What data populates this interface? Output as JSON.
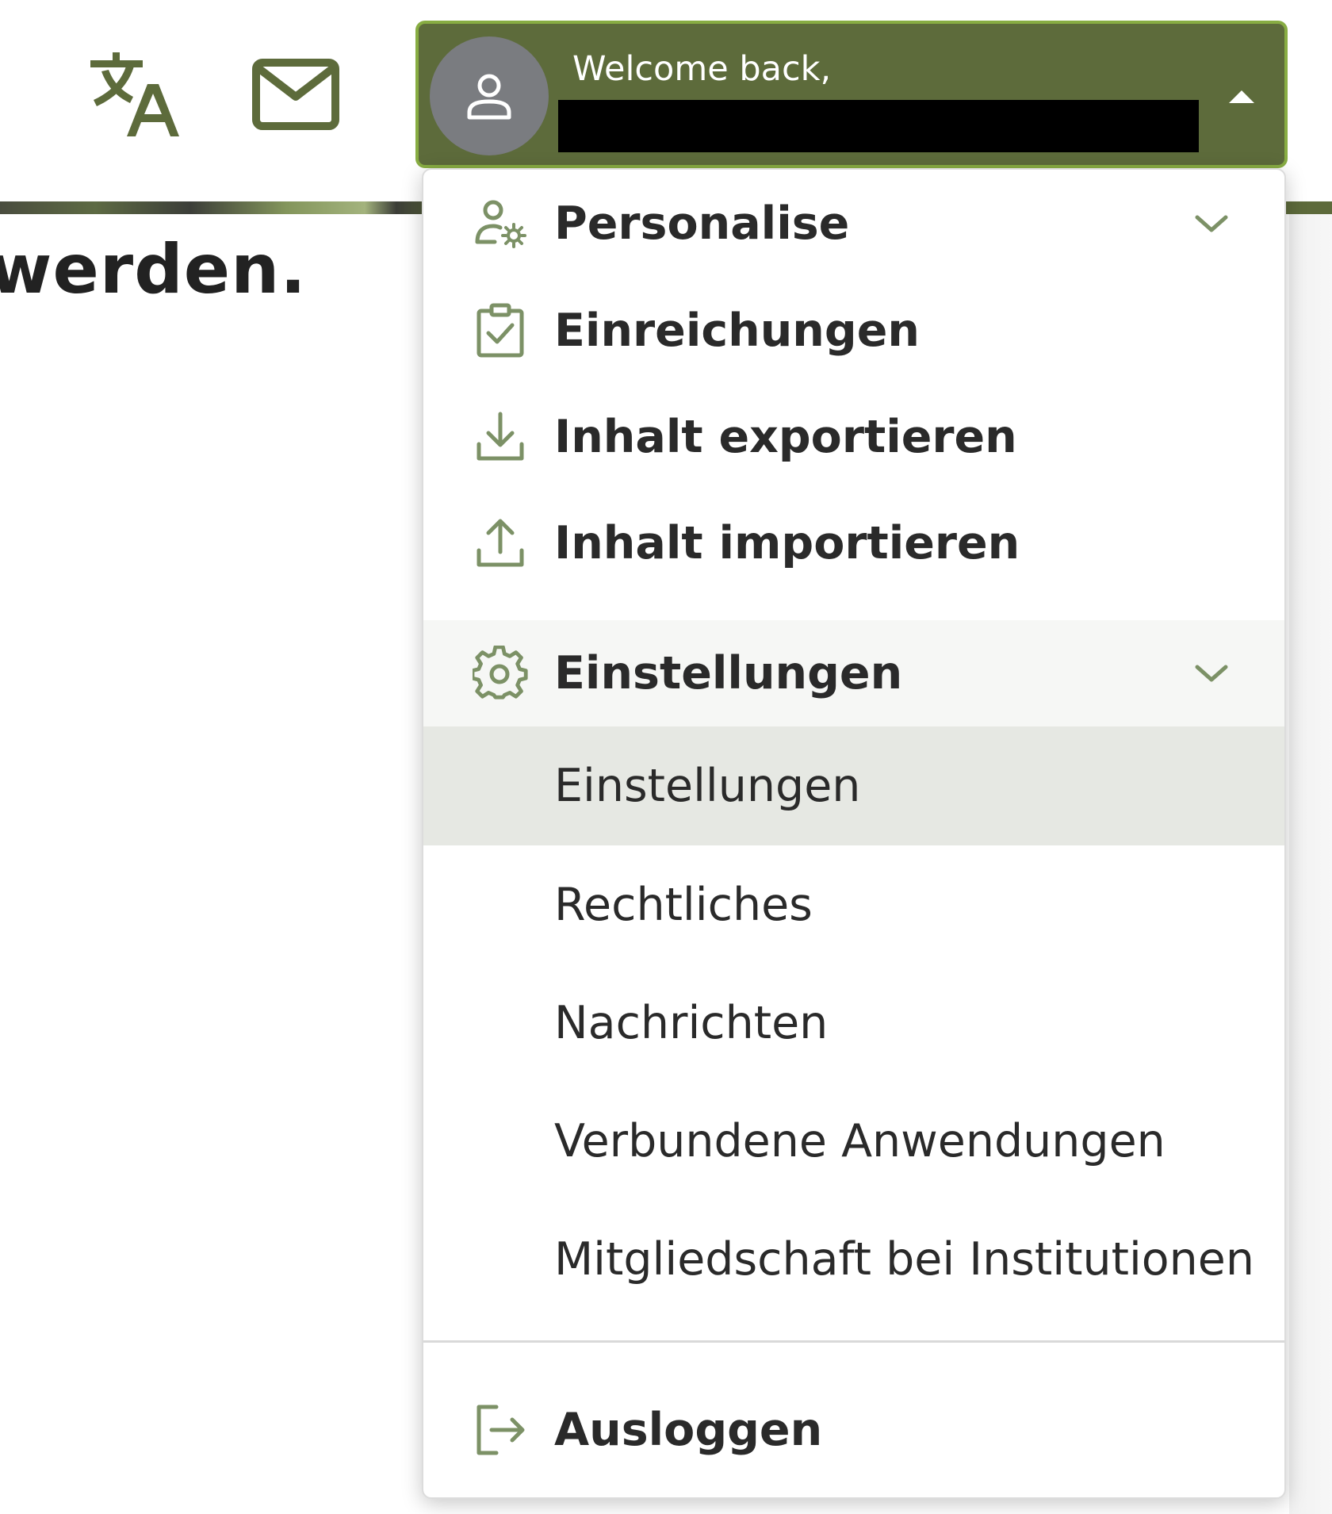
{
  "toolbar": {
    "translate_icon": "translate-icon",
    "mail_icon": "mail-icon"
  },
  "background": {
    "heading_fragment": "werden."
  },
  "user_menu": {
    "welcome_text": "Welcome back,",
    "avatar_icon": "user-icon",
    "caret_icon": "caret-up-icon",
    "accent_color": "#5d6b3b",
    "border_color": "#88ad43"
  },
  "dropdown": {
    "items": [
      {
        "label": "Personalise",
        "icon": "user-gear-icon",
        "expandable": true
      },
      {
        "label": "Einreichungen",
        "icon": "clipboard-check-icon"
      },
      {
        "label": "Inhalt exportieren",
        "icon": "download-icon"
      },
      {
        "label": "Inhalt importieren",
        "icon": "upload-icon"
      },
      {
        "label": "Einstellungen",
        "icon": "gear-icon",
        "expandable": true,
        "expanded": true
      }
    ],
    "settings_submenu": [
      {
        "label": "Einstellungen",
        "highlighted": true
      },
      {
        "label": "Rechtliches"
      },
      {
        "label": "Nachrichten"
      },
      {
        "label": "Verbundene Anwendungen"
      },
      {
        "label": "Mitgliedschaft bei Institutionen"
      }
    ],
    "logout": {
      "label": "Ausloggen",
      "icon": "logout-icon"
    },
    "icon_color": "#7c9166"
  }
}
